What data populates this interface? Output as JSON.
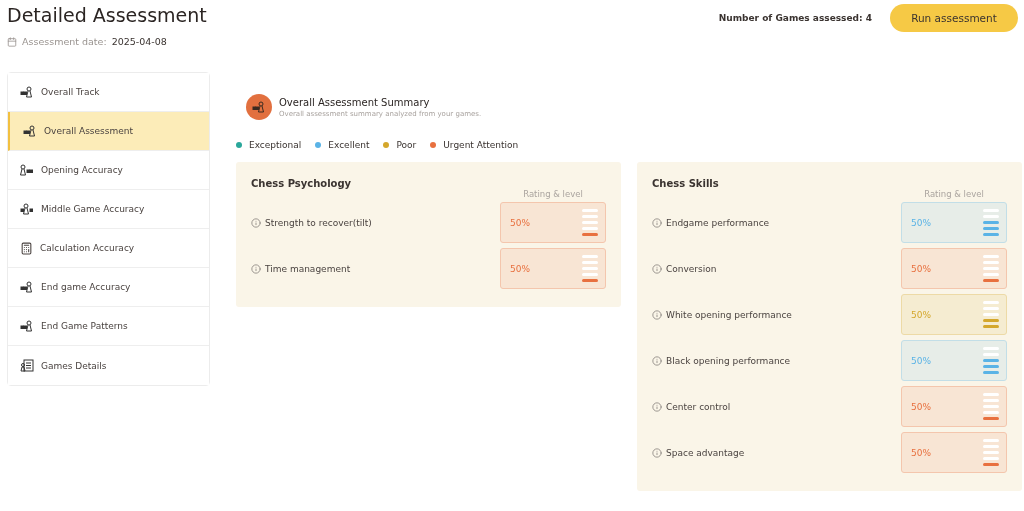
{
  "header": {
    "title": "Detailed Assessment",
    "date_label": "Assessment date:",
    "date": "2025-04-08",
    "games_count": "Number of Games assessed: 4",
    "run_button": "Run assessment"
  },
  "sidebar": {
    "items": [
      {
        "label": "Overall Track",
        "kind": "pawn-right",
        "selected": false
      },
      {
        "label": "Overall Assessment",
        "kind": "pawn-right",
        "selected": true
      },
      {
        "label": "Opening Accuracy",
        "kind": "pawn-left",
        "selected": false
      },
      {
        "label": "Middle Game Accuracy",
        "kind": "pawn-middle",
        "selected": false
      },
      {
        "label": "Calculation Accuracy",
        "kind": "calculator",
        "selected": false
      },
      {
        "label": "End game Accuracy",
        "kind": "pawn-right",
        "selected": false
      },
      {
        "label": "End Game Patterns",
        "kind": "pawn-right",
        "selected": false
      },
      {
        "label": "Games Details",
        "kind": "document",
        "selected": false
      }
    ]
  },
  "summary": {
    "title": "Overall Assessment Summary",
    "subtitle": "Overall assessment summary analyzed from your games."
  },
  "legend": [
    {
      "label": "Exceptional",
      "color": "#2aa79b"
    },
    {
      "label": "Excellent",
      "color": "#5ab3e6"
    },
    {
      "label": "Poor",
      "color": "#d4a72c"
    },
    {
      "label": "Urgent Attention",
      "color": "#e8703f"
    }
  ],
  "panels": [
    {
      "title": "Chess Psychology",
      "rating_heading": "Rating & level",
      "rows": [
        {
          "label": "Strength to recover(tilt)",
          "value": "50%",
          "color": "#e8703f",
          "level": 0.2
        },
        {
          "label": "Time management",
          "value": "50%",
          "color": "#e8703f",
          "level": 0.2
        }
      ]
    },
    {
      "title": "Chess Skills",
      "rating_heading": "Rating & level",
      "rows": [
        {
          "label": "Endgame performance",
          "value": "50%",
          "color": "#5ab3e6",
          "level": 0.6
        },
        {
          "label": "Conversion",
          "value": "50%",
          "color": "#e8703f",
          "level": 0.2
        },
        {
          "label": "White opening performance",
          "value": "50%",
          "color": "#d4a72c",
          "level": 0.4
        },
        {
          "label": "Black opening performance",
          "value": "50%",
          "color": "#5ab3e6",
          "level": 0.6
        },
        {
          "label": "Center control",
          "value": "50%",
          "color": "#e8703f",
          "level": 0.2
        },
        {
          "label": "Space advantage",
          "value": "50%",
          "color": "#e8703f",
          "level": 0.2
        }
      ]
    }
  ]
}
